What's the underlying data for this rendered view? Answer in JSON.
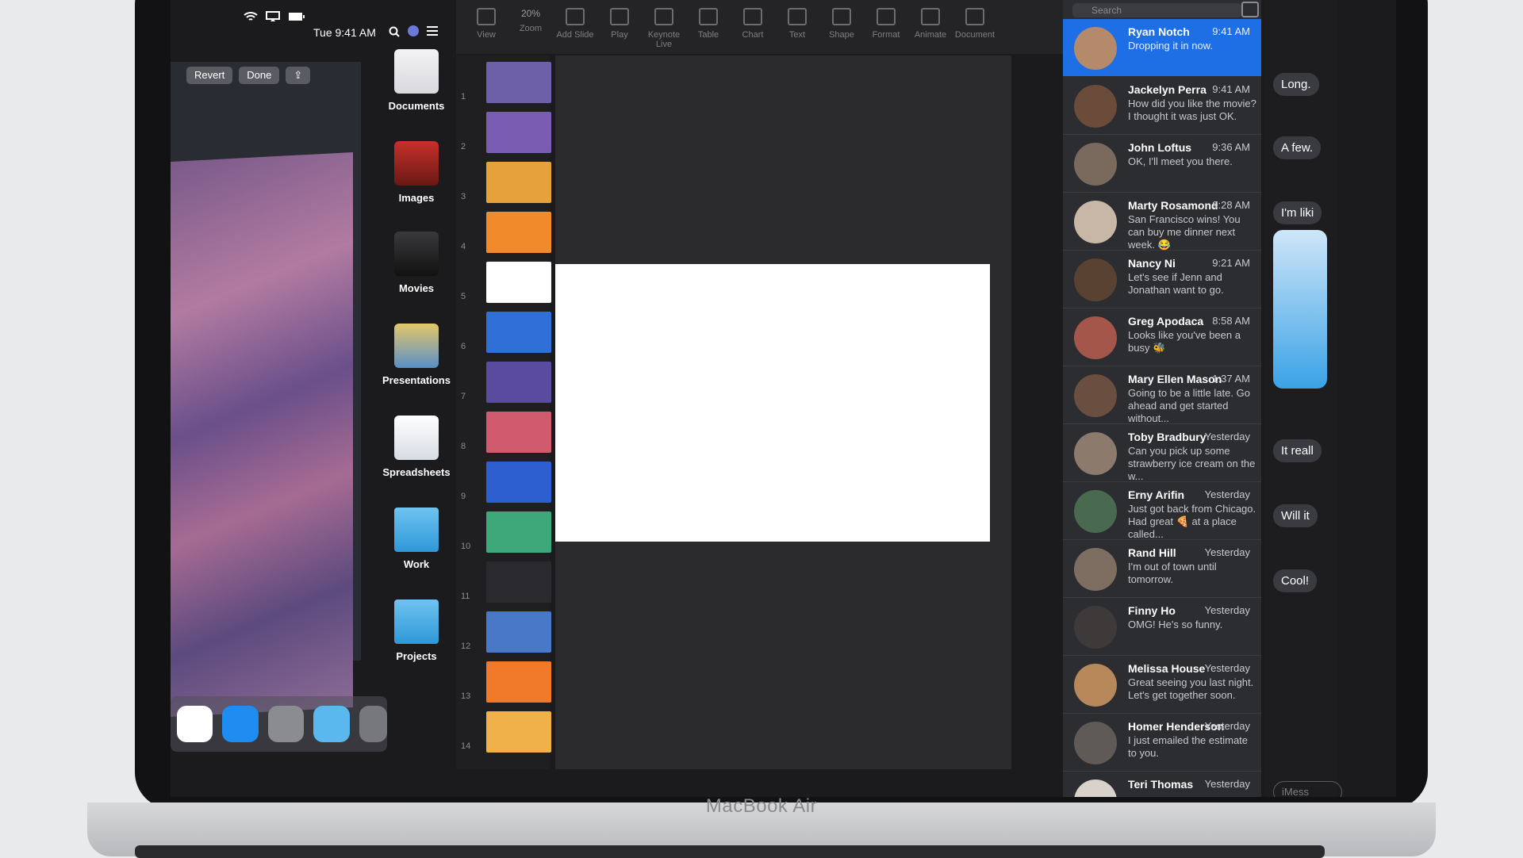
{
  "menubar": {
    "clock": "Tue 9:41 AM"
  },
  "photos": {
    "revert_label": "Revert",
    "done_label": "Done"
  },
  "stacks": [
    {
      "label": "Documents",
      "icon": "documents-icon"
    },
    {
      "label": "Images",
      "icon": "images-icon"
    },
    {
      "label": "Movies",
      "icon": "movies-icon"
    },
    {
      "label": "Presentations",
      "icon": "presentations-icon"
    },
    {
      "label": "Spreadsheets",
      "icon": "spreadsheets-icon"
    },
    {
      "label": "Work",
      "icon": "folder-icon"
    },
    {
      "label": "Projects",
      "icon": "folder-icon"
    }
  ],
  "keynote": {
    "toolbar": [
      "View",
      "Zoom",
      "Add Slide",
      "Play",
      "Keynote Live",
      "Table",
      "Chart",
      "Text",
      "Shape",
      "Format",
      "Animate",
      "Document"
    ],
    "zoom_value": "20%",
    "slide_numbers": [
      "1",
      "2",
      "3",
      "4",
      "5",
      "6",
      "7",
      "8",
      "9",
      "10",
      "11",
      "12",
      "13",
      "14"
    ],
    "thumb_colors": [
      "#6d5fa8",
      "#7a5db3",
      "#e6a23a",
      "#f08a2a",
      "#ffffff",
      "#2f6fd6",
      "#5a4aa0",
      "#d05a6e",
      "#2d5fd0",
      "#3fa87a",
      "#2a2a2e",
      "#4a78c8",
      "#f07a2a",
      "#f0b04a"
    ]
  },
  "messages": {
    "search_placeholder": "Search",
    "conversations": [
      {
        "name": "Ryan Notch",
        "time": "9:41 AM",
        "preview": "Dropping it in now.",
        "avatar_color": "#b48a6a"
      },
      {
        "name": "Jackelyn Perra",
        "time": "9:41 AM",
        "preview": "How did you like the movie? I thought it was just OK.",
        "avatar_color": "#6b4b3a"
      },
      {
        "name": "John Loftus",
        "time": "9:36 AM",
        "preview": "OK, I'll meet you there.",
        "avatar_color": "#7a6a5e"
      },
      {
        "name": "Marty Rosamond",
        "time": "9:28 AM",
        "preview": "San Francisco wins! You can buy me dinner next week. 😂",
        "avatar_color": "#c8b6a6"
      },
      {
        "name": "Nancy Ni",
        "time": "9:21 AM",
        "preview": "Let's see if Jenn and Jonathan want to go.",
        "avatar_color": "#5a4232"
      },
      {
        "name": "Greg Apodaca",
        "time": "8:58 AM",
        "preview": "Looks like you've been a busy 🐝",
        "avatar_color": "#a4564a"
      },
      {
        "name": "Mary Ellen Mason",
        "time": "1:37 AM",
        "preview": "Going to be a little late. Go ahead and get started without...",
        "avatar_color": "#6a4e40"
      },
      {
        "name": "Toby Bradbury",
        "time": "Yesterday",
        "preview": "Can you pick up some strawberry ice cream on the w...",
        "avatar_color": "#8c7a6c"
      },
      {
        "name": "Erny Arifin",
        "time": "Yesterday",
        "preview": "Just got back from Chicago. Had great 🍕 at a place called...",
        "avatar_color": "#4a6a50"
      },
      {
        "name": "Rand Hill",
        "time": "Yesterday",
        "preview": "I'm out of town until tomorrow.",
        "avatar_color": "#7e6e62"
      },
      {
        "name": "Finny Ho",
        "time": "Yesterday",
        "preview": "OMG! He's so funny.",
        "avatar_color": "#3e3a3a"
      },
      {
        "name": "Melissa House",
        "time": "Yesterday",
        "preview": "Great seeing you last night. Let's get together soon.",
        "avatar_color": "#b7895a"
      },
      {
        "name": "Homer Henderson",
        "time": "Yesterday",
        "preview": "I just emailed the estimate to you.",
        "avatar_color": "#5f5a55"
      },
      {
        "name": "Teri Thomas",
        "time": "Yesterday",
        "preview": "",
        "avatar_color": "#d8d2cb"
      }
    ]
  },
  "transcript": {
    "bubbles": [
      "Long.",
      "A few.",
      "I'm liki",
      "It reall",
      "Will it",
      "Cool!"
    ],
    "input_placeholder": "iMess"
  },
  "device_label": "MacBook Air"
}
